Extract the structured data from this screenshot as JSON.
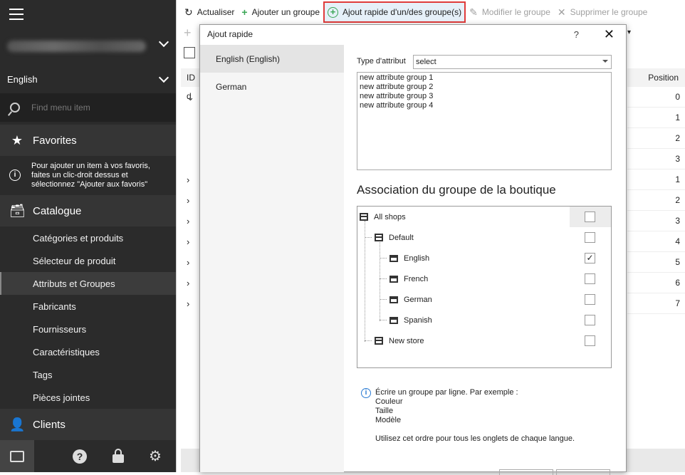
{
  "sidebar": {
    "language": "English",
    "search_placeholder": "Find menu item",
    "favorites_label": "Favorites",
    "favorites_hint": "Pour ajouter un item à vos favoris, faites un clic-droit dessus et sélectionnez \"Ajouter aux favoris\"",
    "catalogue_label": "Catalogue",
    "menu_items": [
      "Catégories et produits",
      "Sélecteur de produit",
      "Attributs et Groupes",
      "Fabricants",
      "Fournisseurs",
      "Caractéristiques",
      "Tags",
      "Pièces jointes"
    ],
    "active_item": "Attributs et Groupes",
    "clients_label": "Clients",
    "help_glyph": "?",
    "settings_glyph": "⚙"
  },
  "toolbar": {
    "refresh": "Actualiser",
    "add_group": "Ajouter un groupe",
    "quick_add": "Ajout rapide d'un/des groupe(s)",
    "edit_group": "Modifier le groupe",
    "delete_group": "Supprimer le groupe"
  },
  "grid": {
    "col_id": "ID d",
    "col_position": "Position",
    "positions": [
      "0",
      "1",
      "2",
      "3",
      "1",
      "2",
      "3",
      "4",
      "5",
      "6",
      "7"
    ],
    "row_toggles": [
      "⌄",
      "",
      "",
      "",
      "›",
      "›",
      "›",
      "›",
      "›",
      "›",
      "›"
    ]
  },
  "dialog": {
    "title": "Ajout rapide",
    "help": "?",
    "close": "✕",
    "tabs": [
      "English (English)",
      "German"
    ],
    "attr_type_label": "Type d'attribut",
    "attr_type_value": "select",
    "groups_text": "new attribute group 1\nnew attribute group 2\nnew attribute group 3\nnew attribute group 4",
    "assoc_title": "Association du groupe de la boutique",
    "shops": [
      {
        "label": "All shops",
        "checked": false
      },
      {
        "label": "Default",
        "checked": false
      },
      {
        "label": "English",
        "checked": true
      },
      {
        "label": "French",
        "checked": false
      },
      {
        "label": "German",
        "checked": false
      },
      {
        "label": "Spanish",
        "checked": false
      },
      {
        "label": "New store",
        "checked": false
      }
    ],
    "info_text": "Écrire un groupe par ligne. Par exemple :\nCouleur\nTaille\nModèle\n\nUtilisez cet ordre pour tous les onglets de chaque langue.",
    "check_mark": "✓"
  }
}
